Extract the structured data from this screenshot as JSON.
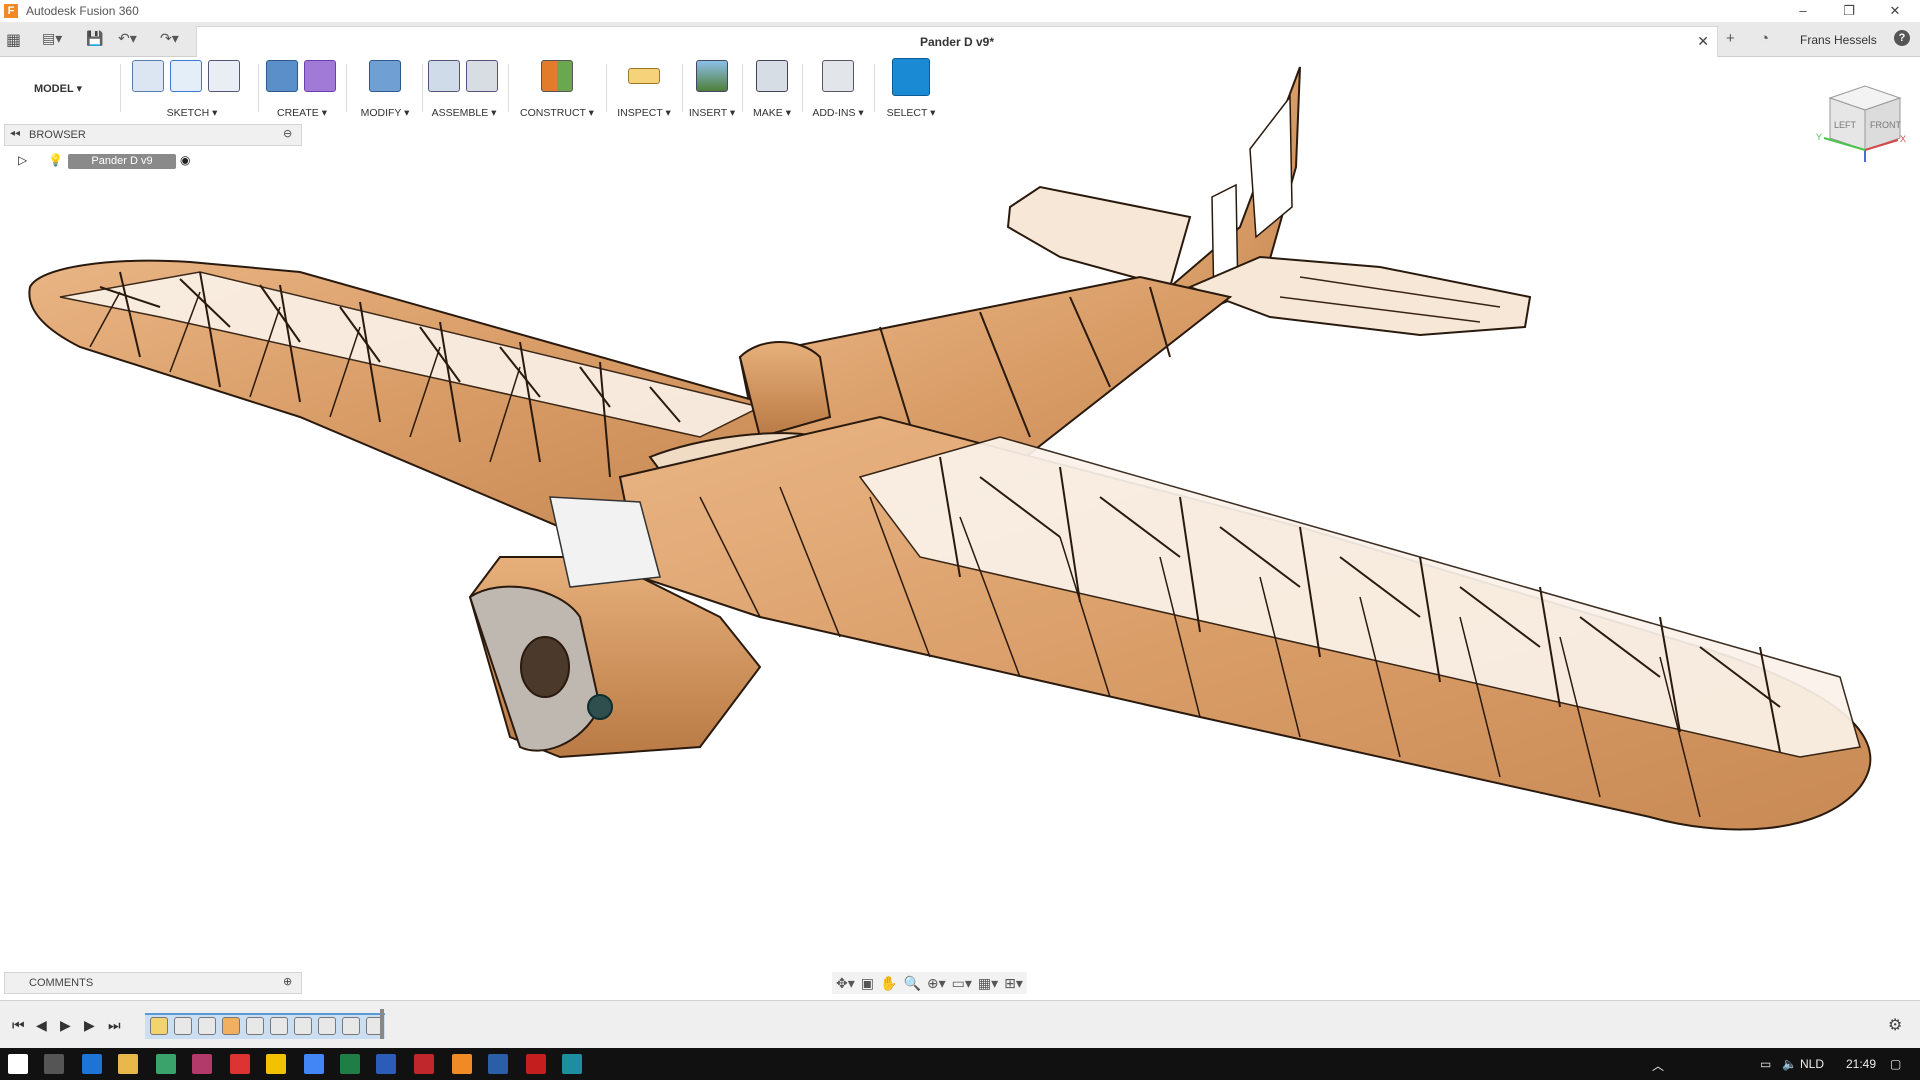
{
  "window": {
    "app_title": "Autodesk Fusion 360",
    "minimize": "–",
    "restore": "❐",
    "close": "✕"
  },
  "tabs": {
    "document_name": "Pander D v9*",
    "close": "✕",
    "add": "+",
    "user": "Frans Hessels",
    "help": "?"
  },
  "toolbar": {
    "workspace": "MODEL ▾",
    "groups": [
      {
        "label": "SKETCH ▾"
      },
      {
        "label": "CREATE ▾"
      },
      {
        "label": "MODIFY ▾"
      },
      {
        "label": "ASSEMBLE ▾"
      },
      {
        "label": "CONSTRUCT ▾"
      },
      {
        "label": "INSPECT ▾"
      },
      {
        "label": "INSERT ▾"
      },
      {
        "label": "MAKE ▾"
      },
      {
        "label": "ADD-INS ▾"
      },
      {
        "label": "SELECT ▾"
      }
    ]
  },
  "browser": {
    "title": "BROWSER",
    "root_node": "Pander D v9"
  },
  "viewcube": {
    "left": "LEFT",
    "front": "FRONT",
    "x": "X",
    "y": "Y"
  },
  "comments": {
    "title": "COMMENTS"
  },
  "taskbar": {
    "language": "NLD",
    "time": "21:49"
  }
}
